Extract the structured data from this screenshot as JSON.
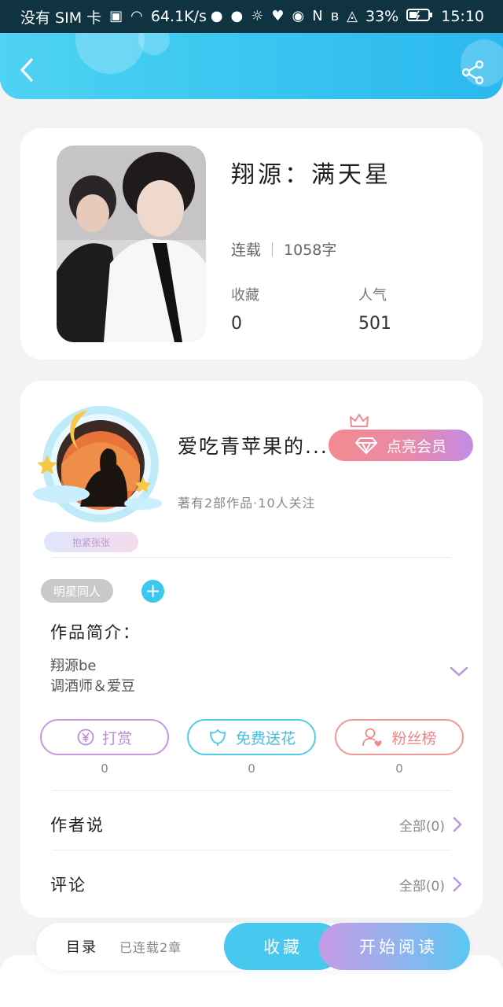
{
  "status_bar": {
    "carrier": "没有 SIM 卡",
    "speed": "64.1K/s",
    "battery": "33%",
    "time": "15:10"
  },
  "header": {
    "back_icon": "chevron-left-icon",
    "share_icon": "share-icon"
  },
  "book": {
    "title": "翔源：满天星",
    "status": "连载",
    "word_count": "1058字",
    "favorites_label": "收藏",
    "favorites_value": "0",
    "popularity_label": "人气",
    "popularity_value": "501"
  },
  "author": {
    "name": "爱吃青苹果的...",
    "vip_button": "点亮会员",
    "summary": "著有2部作品·10人关注",
    "badge": "抱紧张张",
    "tag": "明星同人",
    "tag_add": "+",
    "intro_title": "作品简介：",
    "intro_lines": [
      "翔源be",
      "调酒师＆爱豆"
    ]
  },
  "actions": [
    {
      "label": "打赏",
      "count": "0",
      "color": "#c08bdc",
      "icon": "yen-icon"
    },
    {
      "label": "免费送花",
      "count": "0",
      "color": "#4cc7ea",
      "icon": "flower-icon"
    },
    {
      "label": "粉丝榜",
      "count": "0",
      "color": "#ee8a8a",
      "icon": "fan-ranking-icon"
    }
  ],
  "sections": {
    "author_says": {
      "label": "作者说",
      "link": "全部(0)"
    },
    "comments": {
      "label": "评论",
      "link": "全部(0)"
    }
  },
  "bottom_bar": {
    "catalog_label": "目录",
    "catalog_count": "已连载2章",
    "collect_button": "收藏",
    "read_button": "开始阅读"
  },
  "colors": {
    "accent": "#3bc7f0",
    "vip_gradient_start": "#f28a8f",
    "vip_gradient_end": "#c38be6"
  }
}
